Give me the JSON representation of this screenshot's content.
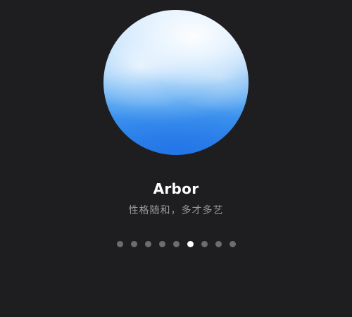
{
  "character": {
    "name": "Arbor",
    "description": "性格随和，多才多艺"
  },
  "pagination": {
    "total": 9,
    "current": 6
  },
  "colors": {
    "background": "#1e1d1f",
    "dot_inactive": "#6d6c70",
    "dot_active": "#ffffff",
    "orb_sky": "#2a7fe8"
  },
  "icons": {
    "avatar": "sky-orb"
  }
}
